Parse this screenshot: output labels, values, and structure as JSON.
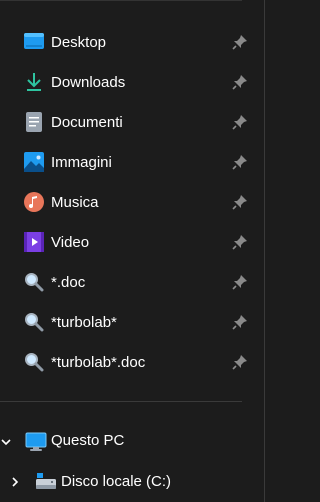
{
  "quick_access": [
    {
      "label": "Desktop",
      "icon": "desktop-icon"
    },
    {
      "label": "Downloads",
      "icon": "download-icon"
    },
    {
      "label": "Documenti",
      "icon": "document-icon"
    },
    {
      "label": "Immagini",
      "icon": "pictures-icon"
    },
    {
      "label": "Musica",
      "icon": "music-icon"
    },
    {
      "label": "Video",
      "icon": "video-icon"
    },
    {
      "label": "*.doc",
      "icon": "search-icon"
    },
    {
      "label": "*turbolab*",
      "icon": "search-icon"
    },
    {
      "label": "*turbolab*.doc",
      "icon": "search-icon"
    }
  ],
  "this_pc": {
    "label": "Questo PC",
    "icon": "computer-icon",
    "expanded": true
  },
  "drives": [
    {
      "label": "Disco locale (C:)",
      "icon": "drive-icon",
      "expanded": false
    }
  ],
  "colors": {
    "background": "#1c1c1c",
    "text": "#ffffff",
    "pin": "#8a8a8a",
    "desktop_blue": "#1e9bf0",
    "download_green": "#2ec4a0",
    "music_orange": "#e8765a",
    "video_purple": "#7b3fe4"
  }
}
